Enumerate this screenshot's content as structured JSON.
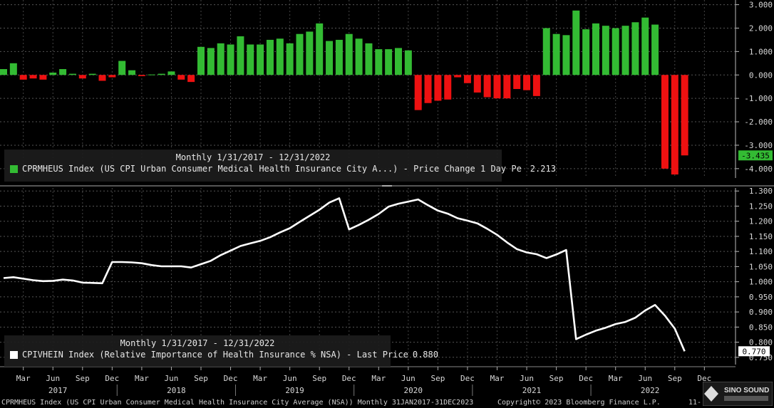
{
  "top_legend": {
    "period": "Monthly 1/31/2017 - 12/31/2022",
    "series": "CPRMHEUS Index (US CPI Urban Consumer Medical Health Insurance City A...) - Price Change 1 Day Pe",
    "value": "2.213",
    "color": "#33bb33"
  },
  "bottom_legend": {
    "period": "Monthly 1/31/2017 - 12/31/2022",
    "series": "CPIVHEIN Index (Relative Importance of Health Insurance % NSA) - Last Price",
    "value": "0.880",
    "color": "#ffffff"
  },
  "footer": {
    "left": "CPRMHEUS Index (US CPI Urban Consumer Medical Health Insurance City Average (NSA)) Monthly 31JAN2017-31DEC2023",
    "copyright": "Copyright© 2023 Bloomberg Finance L.P.",
    "right": "11-"
  },
  "logo": {
    "text": "SINO SOUND"
  },
  "chart_data": [
    {
      "type": "bar",
      "x": [
        "2017-01",
        "2017-02",
        "2017-03",
        "2017-04",
        "2017-05",
        "2017-06",
        "2017-07",
        "2017-08",
        "2017-09",
        "2017-10",
        "2017-11",
        "2017-12",
        "2018-01",
        "2018-02",
        "2018-03",
        "2018-04",
        "2018-05",
        "2018-06",
        "2018-07",
        "2018-08",
        "2018-09",
        "2018-10",
        "2018-11",
        "2018-12",
        "2019-01",
        "2019-02",
        "2019-03",
        "2019-04",
        "2019-05",
        "2019-06",
        "2019-07",
        "2019-08",
        "2019-09",
        "2019-10",
        "2019-11",
        "2019-12",
        "2020-01",
        "2020-02",
        "2020-03",
        "2020-04",
        "2020-05",
        "2020-06",
        "2020-07",
        "2020-08",
        "2020-09",
        "2020-10",
        "2020-11",
        "2020-12",
        "2021-01",
        "2021-02",
        "2021-03",
        "2021-04",
        "2021-05",
        "2021-06",
        "2021-07",
        "2021-08",
        "2021-09",
        "2021-10",
        "2021-11",
        "2021-12",
        "2022-01",
        "2022-02",
        "2022-03",
        "2022-04",
        "2022-05",
        "2022-06",
        "2022-07",
        "2022-08",
        "2022-09",
        "2022-10",
        "2022-11",
        "2022-12"
      ],
      "values": [
        0.25,
        0.5,
        -0.2,
        -0.15,
        -0.2,
        0.1,
        0.25,
        0.05,
        -0.15,
        0.05,
        -0.25,
        -0.1,
        0.6,
        0.2,
        -0.05,
        0.02,
        0.05,
        0.15,
        -0.2,
        -0.3,
        1.2,
        1.15,
        1.35,
        1.3,
        1.65,
        1.3,
        1.3,
        1.5,
        1.55,
        1.35,
        1.75,
        1.85,
        2.2,
        1.45,
        1.5,
        1.75,
        1.55,
        1.35,
        1.1,
        1.1,
        1.15,
        1.05,
        -1.5,
        -1.2,
        -1.1,
        -1.05,
        -0.1,
        -0.35,
        -0.75,
        -0.95,
        -1.0,
        -1.0,
        -0.6,
        -0.65,
        -0.9,
        2.0,
        1.75,
        1.7,
        2.75,
        1.95,
        2.2,
        2.1,
        2.0,
        2.1,
        2.25,
        2.45,
        2.15,
        -4.0,
        -4.25,
        -3.435
      ],
      "colors": {
        "positive": "#33bb33",
        "negative": "#ee1111"
      },
      "ylim": [
        -4.4,
        3.2
      ],
      "yticks": [
        "3.000",
        "2.000",
        "1.000",
        "0.000",
        "-1.000",
        "-2.000",
        "-3.000",
        "-4.000"
      ],
      "last_value_label": "-3.435"
    },
    {
      "type": "line",
      "x": [
        "2017-01",
        "2017-02",
        "2017-03",
        "2017-04",
        "2017-05",
        "2017-06",
        "2017-07",
        "2017-08",
        "2017-09",
        "2017-10",
        "2017-11",
        "2017-12",
        "2018-01",
        "2018-02",
        "2018-03",
        "2018-04",
        "2018-05",
        "2018-06",
        "2018-07",
        "2018-08",
        "2018-09",
        "2018-10",
        "2018-11",
        "2018-12",
        "2019-01",
        "2019-02",
        "2019-03",
        "2019-04",
        "2019-05",
        "2019-06",
        "2019-07",
        "2019-08",
        "2019-09",
        "2019-10",
        "2019-11",
        "2019-12",
        "2020-01",
        "2020-02",
        "2020-03",
        "2020-04",
        "2020-05",
        "2020-06",
        "2020-07",
        "2020-08",
        "2020-09",
        "2020-10",
        "2020-11",
        "2020-12",
        "2021-01",
        "2021-02",
        "2021-03",
        "2021-04",
        "2021-05",
        "2021-06",
        "2021-07",
        "2021-08",
        "2021-09",
        "2021-10",
        "2021-11",
        "2021-12",
        "2022-01",
        "2022-02",
        "2022-03",
        "2022-04",
        "2022-05",
        "2022-06",
        "2022-07",
        "2022-08",
        "2022-09",
        "2022-10",
        "2022-11",
        "2022-12"
      ],
      "values": [
        1.012,
        1.015,
        1.01,
        1.005,
        1.002,
        1.003,
        1.007,
        1.004,
        0.997,
        0.996,
        0.995,
        1.065,
        1.065,
        1.064,
        1.061,
        1.055,
        1.051,
        1.051,
        1.051,
        1.047,
        1.058,
        1.069,
        1.088,
        1.103,
        1.118,
        1.127,
        1.135,
        1.147,
        1.163,
        1.177,
        1.198,
        1.218,
        1.238,
        1.262,
        1.276,
        1.173,
        1.188,
        1.205,
        1.224,
        1.248,
        1.258,
        1.265,
        1.272,
        1.253,
        1.235,
        1.225,
        1.21,
        1.202,
        1.193,
        1.175,
        1.155,
        1.13,
        1.108,
        1.097,
        1.091,
        1.078,
        1.09,
        1.105,
        0.81,
        0.825,
        0.838,
        0.848,
        0.86,
        0.867,
        0.881,
        0.905,
        0.923,
        0.888,
        0.845,
        0.77
      ],
      "color": "#ffffff",
      "ylim": [
        0.726,
        1.31
      ],
      "yticks": [
        "1.300",
        "1.250",
        "1.200",
        "1.150",
        "1.100",
        "1.050",
        "1.000",
        "0.950",
        "0.900",
        "0.850",
        "0.800",
        "0.750"
      ],
      "last_value_label": "0.770"
    }
  ],
  "x_axis": {
    "month_labels": [
      "Mar",
      "Jun",
      "Sep",
      "Dec",
      "Mar",
      "Jun",
      "Sep",
      "Dec",
      "Mar",
      "Jun",
      "Sep",
      "Dec",
      "Mar",
      "Jun",
      "Sep",
      "Dec",
      "Mar",
      "Jun",
      "Sep",
      "Dec",
      "Mar",
      "Jun",
      "Sep",
      "Dec"
    ],
    "year_labels": [
      "2017",
      "2018",
      "2019",
      "2020",
      "2021",
      "2022"
    ]
  }
}
